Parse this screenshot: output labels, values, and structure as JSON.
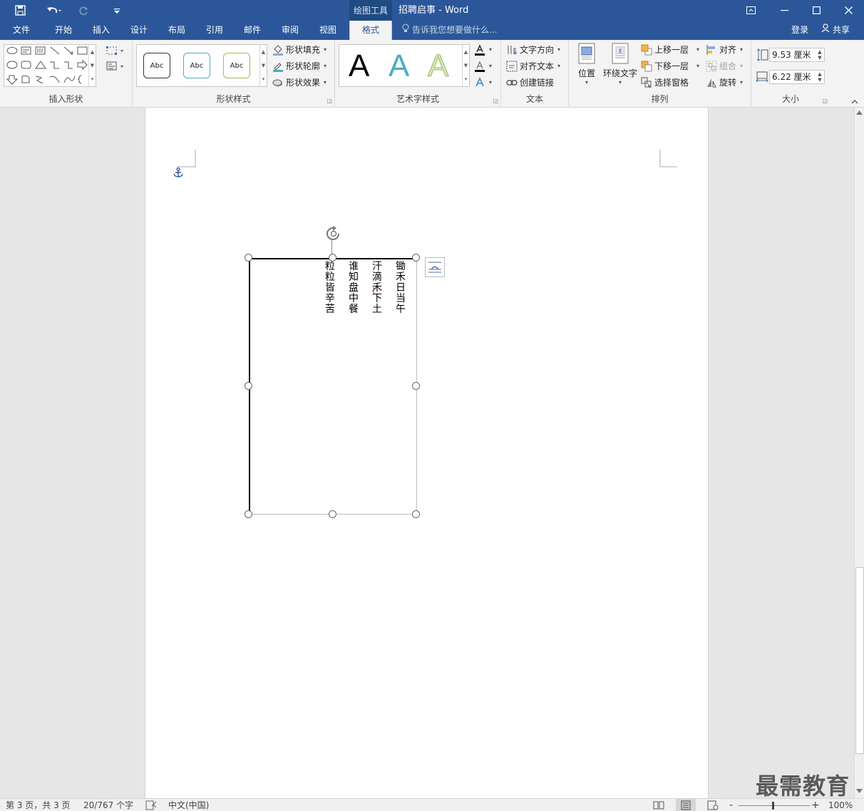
{
  "window": {
    "context_title": "绘图工具",
    "doc_title": "招聘启事 - Word"
  },
  "tabs": [
    {
      "label": "文件"
    },
    {
      "label": "开始"
    },
    {
      "label": "插入"
    },
    {
      "label": "设计"
    },
    {
      "label": "布局"
    },
    {
      "label": "引用"
    },
    {
      "label": "邮件"
    },
    {
      "label": "审阅"
    },
    {
      "label": "视图"
    },
    {
      "label": "格式",
      "active": true
    }
  ],
  "tellme": {
    "placeholder": "告诉我您想要做什么..."
  },
  "account": {
    "login": "登录",
    "share": "共享"
  },
  "ribbon": {
    "insert_shapes": {
      "label": "插入形状"
    },
    "shape_styles": {
      "label": "形状样式",
      "preset": "Abc",
      "fill": "形状填充",
      "outline": "形状轮廓",
      "effects": "形状效果"
    },
    "wordart": {
      "label": "艺术字样式",
      "preset": "A",
      "colors": {
        "black": "#000000",
        "teal": "#4bacc6",
        "olive": "#c4d79b"
      }
    },
    "text": {
      "label": "文本",
      "direction": "文字方向",
      "align": "对齐文本",
      "link": "创建链接"
    },
    "arrange": {
      "label": "排列",
      "position": "位置",
      "wrap": "环绕文字",
      "bring_forward": "上移一层",
      "send_backward": "下移一层",
      "selection_pane": "选择窗格",
      "align": "对齐",
      "group": "组合",
      "rotate": "旋转"
    },
    "size": {
      "label": "大小",
      "height": "9.53 厘米",
      "width": "6.22 厘米"
    }
  },
  "document": {
    "columns": [
      {
        "text": "锄禾日当午"
      },
      {
        "text": "汗滴禾下土"
      },
      {
        "text": "谁知盘中餐"
      },
      {
        "text": "粒粒皆辛苦"
      }
    ]
  },
  "status": {
    "page": "第 3 页，共 3 页",
    "words": "20/767 个字",
    "language": "中文(中国)",
    "zoom": "100%"
  },
  "watermark": "最需教育"
}
